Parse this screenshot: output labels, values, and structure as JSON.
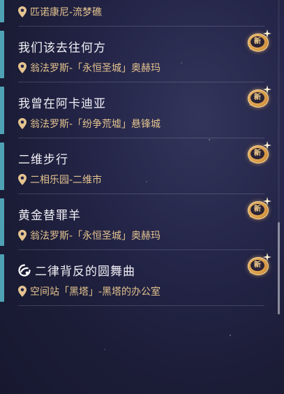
{
  "quests": [
    {
      "title": "",
      "location": "匹诺康尼-流梦礁",
      "is_new": false,
      "has_icon": false
    },
    {
      "title": "我们该去往何方",
      "location": "翁法罗斯-「永恒圣城」奥赫玛",
      "is_new": true,
      "has_icon": false
    },
    {
      "title": "我曾在阿卡迪亚",
      "location": "翁法罗斯-「纷争荒墟」悬锋城",
      "is_new": true,
      "has_icon": false
    },
    {
      "title": "二维步行",
      "location": "二相乐园-二维市",
      "is_new": true,
      "has_icon": false
    },
    {
      "title": "黄金替罪羊",
      "location": "翁法罗斯-「永恒圣城」奥赫玛",
      "is_new": true,
      "has_icon": false
    },
    {
      "title": "二律背反的圆舞曲",
      "location": "空间站「黑塔」-黑塔的办公室",
      "is_new": true,
      "has_icon": true
    }
  ],
  "new_badge_label": "新",
  "colors": {
    "accent_bar": "#4ea2b4",
    "location_text": "#e5c48f",
    "title_text": "#f1f0f6",
    "badge_gold": "#d99a45"
  },
  "icons": {
    "location": "map-pin-icon",
    "new": "new-badge-icon",
    "quest": "quest-type-icon"
  }
}
